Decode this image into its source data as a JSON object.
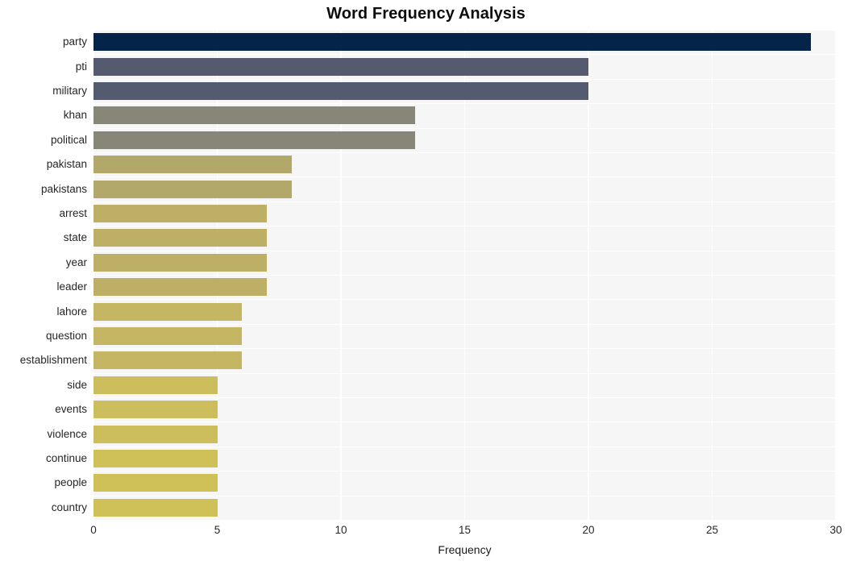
{
  "chart_data": {
    "type": "bar",
    "orientation": "horizontal",
    "title": "Word Frequency Analysis",
    "xlabel": "Frequency",
    "ylabel": "",
    "xlim": [
      0,
      30
    ],
    "xticks": [
      0,
      5,
      10,
      15,
      20,
      25,
      30
    ],
    "xtick_labels": [
      "0",
      "5",
      "10",
      "15",
      "20",
      "25",
      "30"
    ],
    "grid": true,
    "grid_color": "#ffffff",
    "plot_background": "#f6f6f7",
    "figure_background": "#ffffff",
    "legend": null,
    "categories": [
      "party",
      "pti",
      "military",
      "khan",
      "political",
      "pakistan",
      "pakistans",
      "arrest",
      "state",
      "year",
      "leader",
      "lahore",
      "question",
      "establishment",
      "side",
      "events",
      "violence",
      "continue",
      "people",
      "country"
    ],
    "values": [
      29,
      20,
      20,
      13,
      13,
      8,
      8,
      7,
      7,
      7,
      7,
      6,
      6,
      6,
      5,
      5,
      5,
      5,
      5,
      5
    ],
    "bar_colors": [
      "#05244a",
      "#555a6e",
      "#545a6f",
      "#888579",
      "#888579",
      "#b2a86a",
      "#b2a86a",
      "#bdb066",
      "#bdb066",
      "#bdb066",
      "#bdb066",
      "#c4b663",
      "#c4b663",
      "#c4b663",
      "#ccbe5c",
      "#ccbe5c",
      "#ccbe5c",
      "#cfc058",
      "#cfc058",
      "#cfc058"
    ]
  }
}
